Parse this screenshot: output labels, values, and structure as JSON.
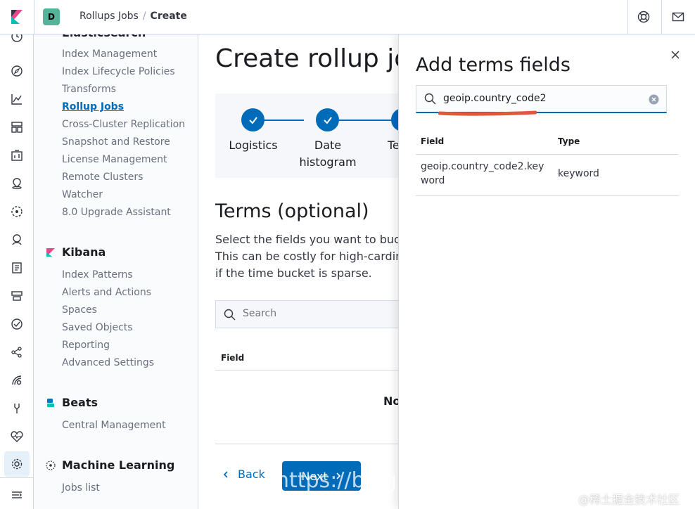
{
  "header": {
    "space_initial": "D",
    "breadcrumbs": [
      "Rollups Jobs",
      "Create"
    ]
  },
  "sidebar": {
    "elasticsearch": {
      "heading": "Elasticsearch",
      "items": [
        "Index Management",
        "Index Lifecycle Policies",
        "Transforms",
        "Rollup Jobs",
        "Cross-Cluster Replication",
        "Snapshot and Restore",
        "License Management",
        "Remote Clusters",
        "Watcher",
        "8.0 Upgrade Assistant"
      ],
      "active": "Rollup Jobs"
    },
    "kibana": {
      "heading": "Kibana",
      "items": [
        "Index Patterns",
        "Alerts and Actions",
        "Spaces",
        "Saved Objects",
        "Reporting",
        "Advanced Settings"
      ]
    },
    "beats": {
      "heading": "Beats",
      "items": [
        "Central Management"
      ]
    },
    "ml": {
      "heading": "Machine Learning",
      "items": [
        "Jobs list"
      ]
    }
  },
  "main": {
    "title": "Create rollup job",
    "steps": [
      {
        "label": "Logistics"
      },
      {
        "label": "Date histogram"
      },
      {
        "label": "Te"
      }
    ],
    "section_title": "Terms (optional)",
    "description": [
      "Select the fields you want to bucke",
      "This can be costly for high-cardina",
      "if the time bucket is sparse."
    ],
    "search_placeholder": "Search",
    "table_header": "Field",
    "empty_text": "No",
    "back_label": "Back",
    "next_label": "Next"
  },
  "flyout": {
    "title": "Add terms fields",
    "search_value": "geoip.country_code2",
    "columns": [
      "Field",
      "Type"
    ],
    "rows": [
      {
        "field": "geoip.country_code2.keyword",
        "type": "keyword"
      }
    ]
  },
  "watermarks": {
    "url": "https://blog",
    "site": "@稀土掘金技术社区"
  },
  "colors": {
    "primary": "#006bb8",
    "space_avatar": "#54b399",
    "annotation": "#e0593c"
  }
}
